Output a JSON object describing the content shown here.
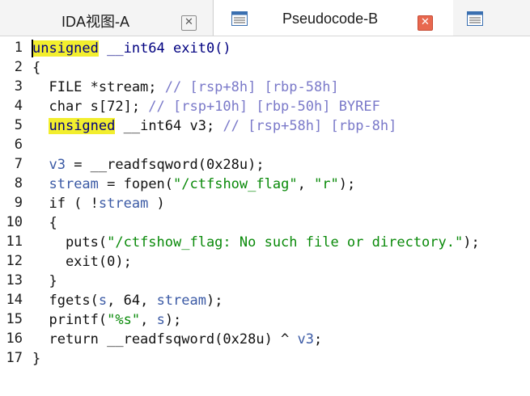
{
  "tabs": [
    {
      "label": "IDA视图-A",
      "active": false
    },
    {
      "label": "Pseudocode-B",
      "active": true
    }
  ],
  "close_glyph": "✕",
  "code": {
    "line_numbers": [
      "1",
      "2",
      "3",
      "4",
      "5",
      "6",
      "7",
      "8",
      "9",
      "10",
      "11",
      "12",
      "13",
      "14",
      "15",
      "16",
      "17"
    ],
    "l1": {
      "kw": "unsigned",
      "rest": " __int64 exit0()"
    },
    "l2": "{",
    "l3": {
      "code": "  FILE *stream; ",
      "comment": "// [rsp+8h] [rbp-58h]"
    },
    "l4": {
      "code": "  char s[72]; ",
      "comment": "// [rsp+10h] [rbp-50h] BYREF"
    },
    "l5": {
      "indent": "  ",
      "kw": "unsigned",
      "code": " __int64 v3; ",
      "comment": "// [rsp+58h] [rbp-8h]"
    },
    "l6": "",
    "l7": {
      "indent": "  ",
      "var": "v3",
      "rest": " = __readfsqword(0x28u);"
    },
    "l8": {
      "indent": "  ",
      "var": "stream",
      "mid": " = fopen(",
      "s1": "\"/ctfshow_flag\"",
      "sep": ", ",
      "s2": "\"r\"",
      "end": ");"
    },
    "l9": {
      "pre": "  if ( !",
      "var": "stream",
      "post": " )"
    },
    "l10": "  {",
    "l11": {
      "pre": "    puts(",
      "str": "\"/ctfshow_flag: No such file or directory.\"",
      "post": ");"
    },
    "l12": "    exit(0);",
    "l13": "  }",
    "l14": {
      "pre": "  fgets(",
      "v1": "s",
      "mid": ", 64, ",
      "v2": "stream",
      "post": ");"
    },
    "l15": {
      "pre": "  printf(",
      "str": "\"%s\"",
      "sep": ", ",
      "var": "s",
      "post": ");"
    },
    "l16": {
      "pre": "  return __readfsqword(0x28u) ^ ",
      "var": "v3",
      "post": ";"
    },
    "l17": "}"
  }
}
